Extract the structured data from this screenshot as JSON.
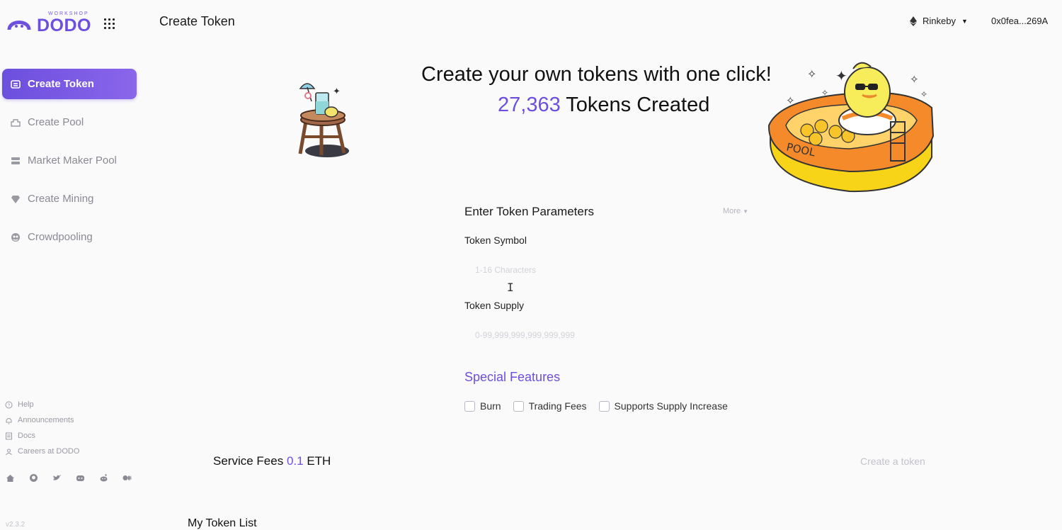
{
  "brand": {
    "workshop": "WORKSHOP",
    "name": "DODO",
    "color": "#6d4fe0"
  },
  "header": {
    "page_title": "Create Token",
    "network": "Rinkeby",
    "wallet": "0x0fea...269A"
  },
  "sidebar": {
    "items": [
      {
        "label": "Create Token",
        "icon": "token-icon",
        "active": true
      },
      {
        "label": "Create Pool",
        "icon": "pool-icon",
        "active": false
      },
      {
        "label": "Market Maker Pool",
        "icon": "market-maker-icon",
        "active": false
      },
      {
        "label": "Create Mining",
        "icon": "mining-icon",
        "active": false
      },
      {
        "label": "Crowdpooling",
        "icon": "crowdpooling-icon",
        "active": false
      }
    ],
    "links": [
      "Help",
      "Announcements",
      "Docs",
      "Careers at DODO"
    ],
    "socials": [
      "home-icon",
      "github-icon",
      "twitter-icon",
      "discord-icon",
      "reddit-icon",
      "medium-icon"
    ],
    "version": "v2.3.2"
  },
  "hero": {
    "title": "Create your own tokens with one click!",
    "count": "27,363",
    "count_suffix": "Tokens Created"
  },
  "form": {
    "title": "Enter Token Parameters",
    "more": "More",
    "symbol_label": "Token Symbol",
    "symbol_placeholder": "1-16 Characters",
    "supply_label": "Token Supply",
    "supply_placeholder": "0-99,999,999,999,999,999",
    "special_title": "Special Features",
    "features": [
      "Burn",
      "Trading Fees",
      "Supports Supply Increase"
    ]
  },
  "footer": {
    "fees_label": "Service Fees",
    "fees_amount": "0.1",
    "fees_unit": "ETH",
    "create_button": "Create a token",
    "list_title": "My Token List"
  }
}
